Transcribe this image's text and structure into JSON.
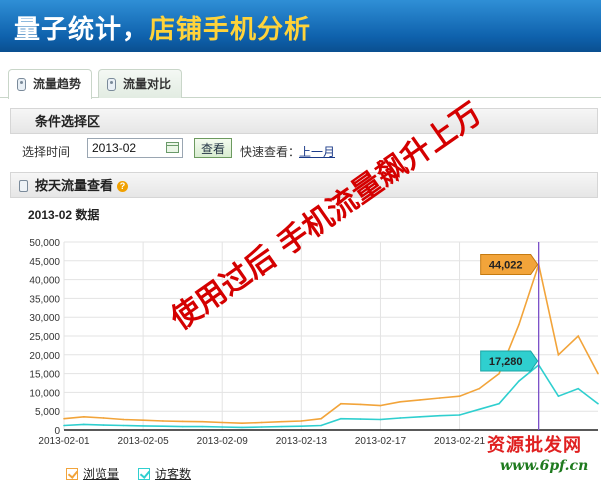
{
  "banner": {
    "title_part1": "量子统计，",
    "title_part2": "店铺手机分析"
  },
  "tabs": [
    {
      "label": "流量趋势",
      "active": true
    },
    {
      "label": "流量对比",
      "active": false
    }
  ],
  "filter": {
    "heading": "条件选择区",
    "select_time_label": "选择时间",
    "date_value": "2013-02",
    "view_button": "查看",
    "quick_view_label": "快速查看：",
    "prev_month_link": "上一月"
  },
  "daily": {
    "heading": "按天流量查看",
    "help_icon": "?"
  },
  "chart_title": "2013-02 数据",
  "overlay_text": "使用过后 手机流量飙升上万",
  "watermark": {
    "line1": "资源批发网",
    "line2": "www.6pf.cn"
  },
  "colors": {
    "page_views": "#f2a43a",
    "visitors": "#2fcfcf",
    "marker_line": "#7a4fc8",
    "banner": "#0f62ad"
  },
  "chart_data": {
    "type": "line",
    "title": "2013-02 数据",
    "x": [
      "2013-02-01",
      "2013-02-02",
      "2013-02-03",
      "2013-02-04",
      "2013-02-05",
      "2013-02-06",
      "2013-02-07",
      "2013-02-08",
      "2013-02-09",
      "2013-02-10",
      "2013-02-11",
      "2013-02-12",
      "2013-02-13",
      "2013-02-14",
      "2013-02-15",
      "2013-02-16",
      "2013-02-17",
      "2013-02-18",
      "2013-02-19",
      "2013-02-20",
      "2013-02-21",
      "2013-02-22",
      "2013-02-23",
      "2013-02-24",
      "2013-02-25",
      "2013-02-26",
      "2013-02-27",
      "2013-02-28"
    ],
    "x_tick_labels": [
      "2013-02-01",
      "2013-02-05",
      "2013-02-09",
      "2013-02-13",
      "2013-02-17",
      "2013-02-21"
    ],
    "ylim": [
      0,
      50000
    ],
    "y_ticks": [
      "50,000",
      "45,000",
      "40,000",
      "35,000",
      "30,000",
      "25,000",
      "20,000",
      "15,000",
      "10,000",
      "5,000",
      "0"
    ],
    "grid": true,
    "legend_position": "bottom-left",
    "series": [
      {
        "name": "浏览量",
        "values": [
          3000,
          3500,
          3200,
          2800,
          2600,
          2400,
          2300,
          2200,
          2000,
          1800,
          2000,
          2200,
          2400,
          3000,
          7000,
          6800,
          6500,
          7500,
          8000,
          8500,
          9000,
          11000,
          15000,
          28000,
          44022,
          20000,
          25000,
          15000
        ]
      },
      {
        "name": "访客数",
        "values": [
          1200,
          1500,
          1300,
          1200,
          1100,
          1000,
          900,
          900,
          800,
          700,
          800,
          900,
          1000,
          1200,
          3000,
          2900,
          2800,
          3200,
          3500,
          3800,
          4000,
          5500,
          7000,
          13000,
          17280,
          9000,
          11000,
          7000
        ]
      }
    ],
    "highlight": {
      "x": "2013-02-25",
      "labels": [
        "44,022",
        "17,280"
      ]
    }
  }
}
